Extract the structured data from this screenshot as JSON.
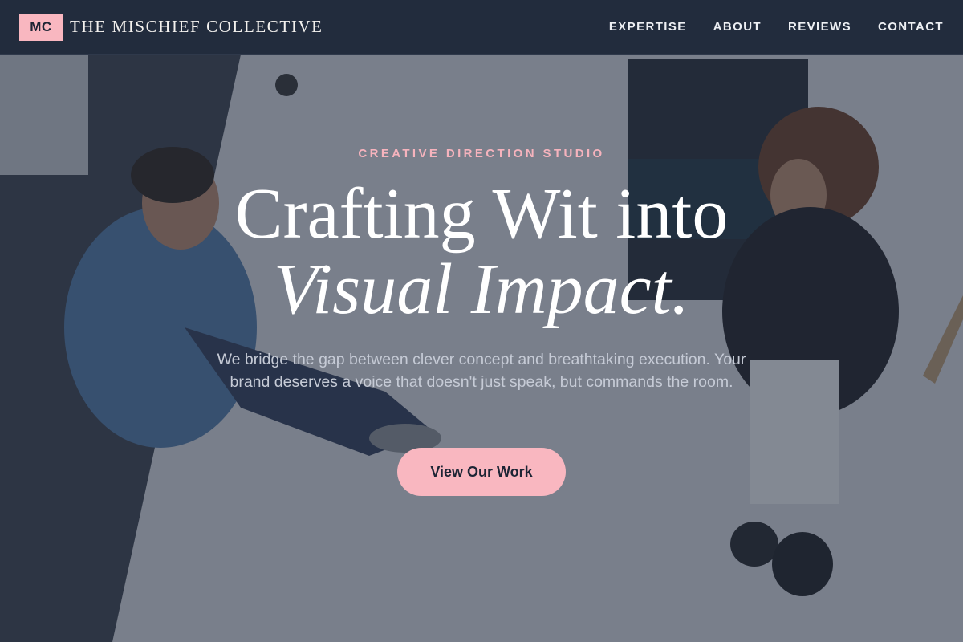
{
  "header": {
    "logo_text": "MC",
    "brand_name": "THE MISCHIEF COLLECTIVE",
    "nav": [
      {
        "label": "EXPERTISE"
      },
      {
        "label": "ABOUT"
      },
      {
        "label": "REVIEWS"
      },
      {
        "label": "CONTACT"
      }
    ]
  },
  "hero": {
    "eyebrow": "CREATIVE DIRECTION STUDIO",
    "headline_line1": "Crafting Wit into",
    "headline_line2": "Visual Impact.",
    "subtext": "We bridge the gap between clever concept and breathtaking execution. Your brand deserves a voice that doesn't just speak, but commands the room.",
    "cta_label": "View Our Work"
  },
  "colors": {
    "accent": "#f9b7c0",
    "header_bg": "#222c3d",
    "text_light": "#ffffff"
  }
}
